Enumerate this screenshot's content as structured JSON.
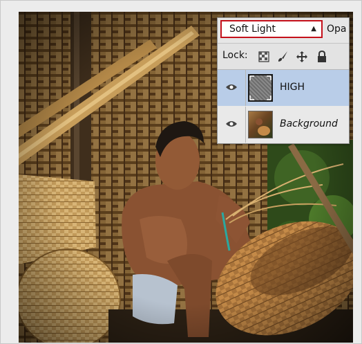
{
  "layers_panel": {
    "blend_mode": "Soft Light",
    "opacity_label": "Opa",
    "lock_label": "Lock:",
    "lock_icons": [
      "lock-transparent-pixels-icon",
      "lock-image-pixels-icon",
      "lock-position-icon",
      "lock-all-icon"
    ],
    "layers": [
      {
        "name": "HIGH",
        "visible": true,
        "selected": true,
        "thumbnail": "gray-high-pass-texture"
      },
      {
        "name": "Background",
        "visible": true,
        "selected": false,
        "thumbnail": "photo-thumbnail"
      }
    ]
  },
  "colors": {
    "highlight_border": "#c4101a",
    "selected_row": "#b9cde8"
  }
}
